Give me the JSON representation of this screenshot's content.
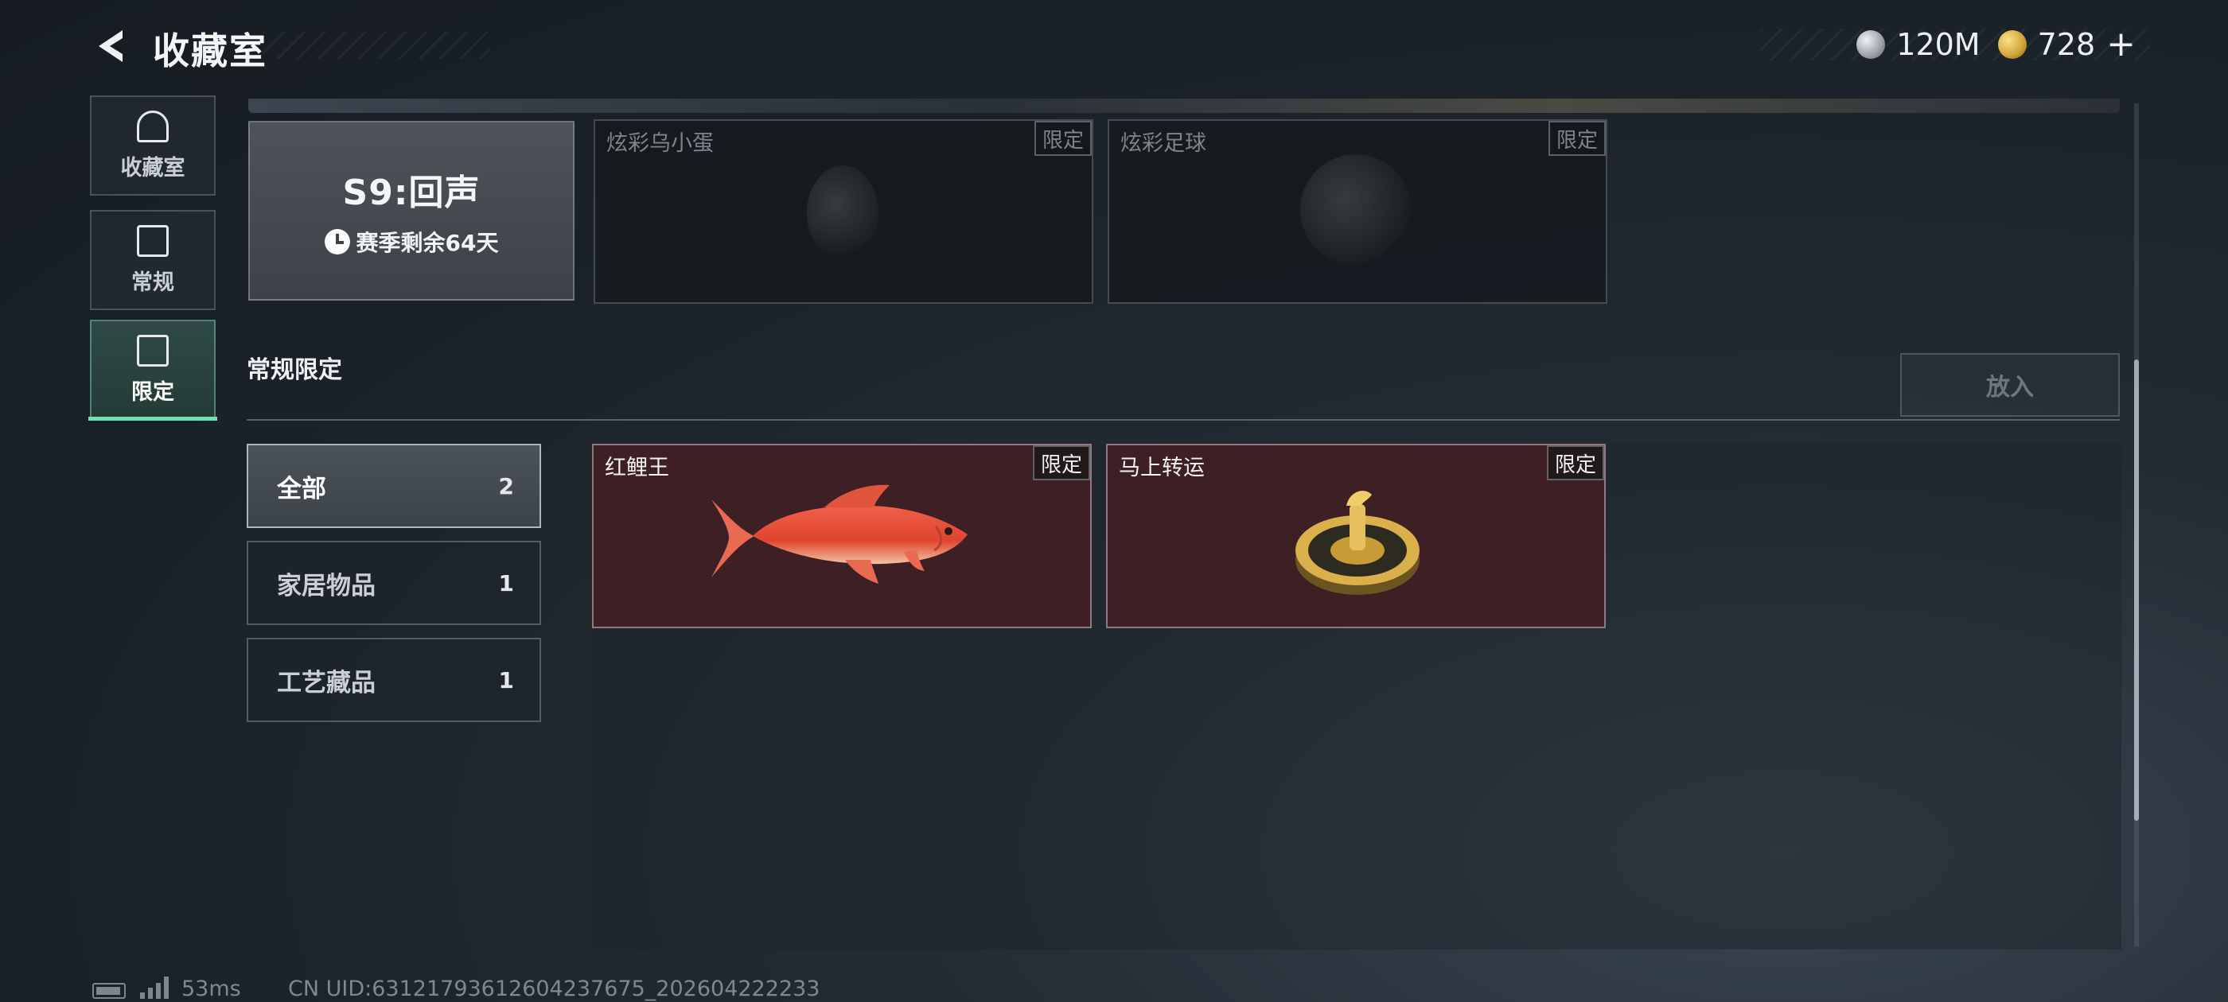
{
  "header": {
    "title": "收藏室",
    "currencies": [
      {
        "icon": "silver-coin-icon",
        "value": "120M"
      },
      {
        "icon": "gold-coin-icon",
        "value": "728"
      }
    ],
    "add_label": "+"
  },
  "sidebar": {
    "items": [
      {
        "label": "收藏室",
        "icon": "collection-room-icon",
        "active": false
      },
      {
        "label": "常规",
        "icon": "regular-icon",
        "active": false
      },
      {
        "label": "限定",
        "icon": "limited-icon",
        "active": true
      }
    ]
  },
  "season": {
    "name": "S9:回声",
    "remaining": "赛季剩余64天"
  },
  "season_items": [
    {
      "name": "炫彩乌小蛋",
      "tag": "限定",
      "owned": false
    },
    {
      "name": "炫彩足球",
      "tag": "限定",
      "owned": false
    }
  ],
  "section": {
    "title": "常规限定",
    "put_in_label": "放入"
  },
  "filters": [
    {
      "label": "全部",
      "count": "2",
      "selected": true
    },
    {
      "label": "家居物品",
      "count": "1",
      "selected": false
    },
    {
      "label": "工艺藏品",
      "count": "1",
      "selected": false
    }
  ],
  "collection_items": [
    {
      "name": "红鲤王",
      "tag": "限定",
      "icon": "red-carp-image"
    },
    {
      "name": "马上转运",
      "tag": "限定",
      "icon": "golden-compass-image"
    }
  ],
  "footer": {
    "ping": "53ms",
    "uid": "CN UID:6312179361260423767​5_202604222233"
  },
  "colors": {
    "accent": "#6fe3b1",
    "owned_card": "#3e1f24"
  }
}
